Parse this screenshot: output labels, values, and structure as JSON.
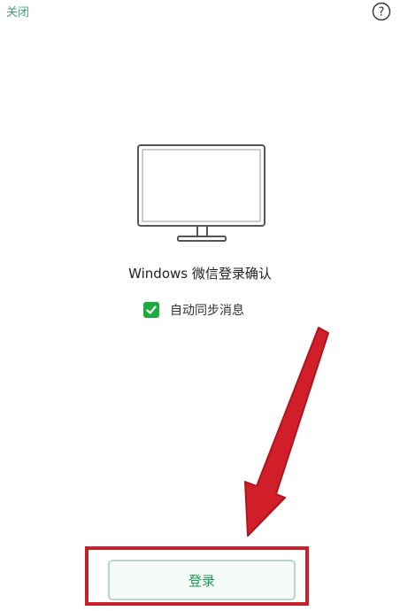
{
  "header": {
    "close_label": "关闭",
    "help_glyph": "?"
  },
  "main": {
    "icon": "monitor-icon",
    "title": "Windows 微信登录确认",
    "sync_checkbox": {
      "label": "自动同步消息",
      "checked": true
    },
    "login_label": "登录"
  },
  "colors": {
    "accent_green": "#1dab3e",
    "link_green": "#3f9e7a",
    "annotation_red": "#c8202a"
  }
}
